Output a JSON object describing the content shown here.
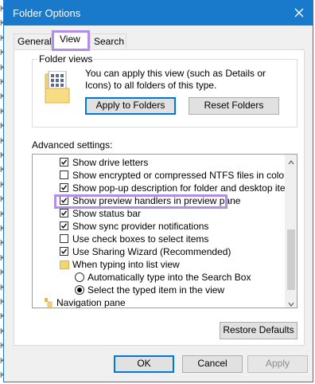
{
  "window": {
    "title": "Folder Options"
  },
  "tabs": [
    {
      "label": "General"
    },
    {
      "label": "View"
    },
    {
      "label": "Search"
    }
  ],
  "folder_views": {
    "legend": "Folder views",
    "description": "You can apply this view (such as Details or Icons) to all folders of this type.",
    "apply_label": "Apply to Folders",
    "reset_label": "Reset Folders"
  },
  "advanced": {
    "label": "Advanced settings:",
    "items": [
      {
        "type": "checkbox",
        "label": "Show drive letters",
        "checked": true
      },
      {
        "type": "checkbox",
        "label": "Show encrypted or compressed NTFS files in color",
        "checked": false
      },
      {
        "type": "checkbox",
        "label": "Show pop-up description for folder and desktop items",
        "checked": true
      },
      {
        "type": "checkbox",
        "label": "Show preview handlers in preview pane",
        "checked": true
      },
      {
        "type": "checkbox",
        "label": "Show status bar",
        "checked": true
      },
      {
        "type": "checkbox",
        "label": "Show sync provider notifications",
        "checked": true
      },
      {
        "type": "checkbox",
        "label": "Use check boxes to select items",
        "checked": false
      },
      {
        "type": "checkbox",
        "label": "Use Sharing Wizard (Recommended)",
        "checked": true
      },
      {
        "type": "folder",
        "label": "When typing into list view"
      },
      {
        "type": "radio",
        "label": "Automatically type into the Search Box",
        "selected": false
      },
      {
        "type": "radio",
        "label": "Select the typed item in the view",
        "selected": true
      },
      {
        "type": "nav",
        "label": "Navigation pane"
      }
    ],
    "restore_label": "Restore Defaults"
  },
  "buttons": {
    "ok": "OK",
    "cancel": "Cancel",
    "apply": "Apply"
  },
  "background_letters": [
    "K",
    "K",
    "K",
    "K",
    "K",
    "K",
    "K",
    "K",
    "K",
    "K",
    "K",
    "K",
    "K",
    "K",
    "K",
    "K",
    "K",
    "K",
    "K",
    "K",
    "K",
    "K",
    "K",
    "K",
    "K",
    "KP"
  ],
  "colors": {
    "titlebar": "#1979ca",
    "highlight": "#b18ee8",
    "dialog_bg": "#f0f0f0"
  }
}
